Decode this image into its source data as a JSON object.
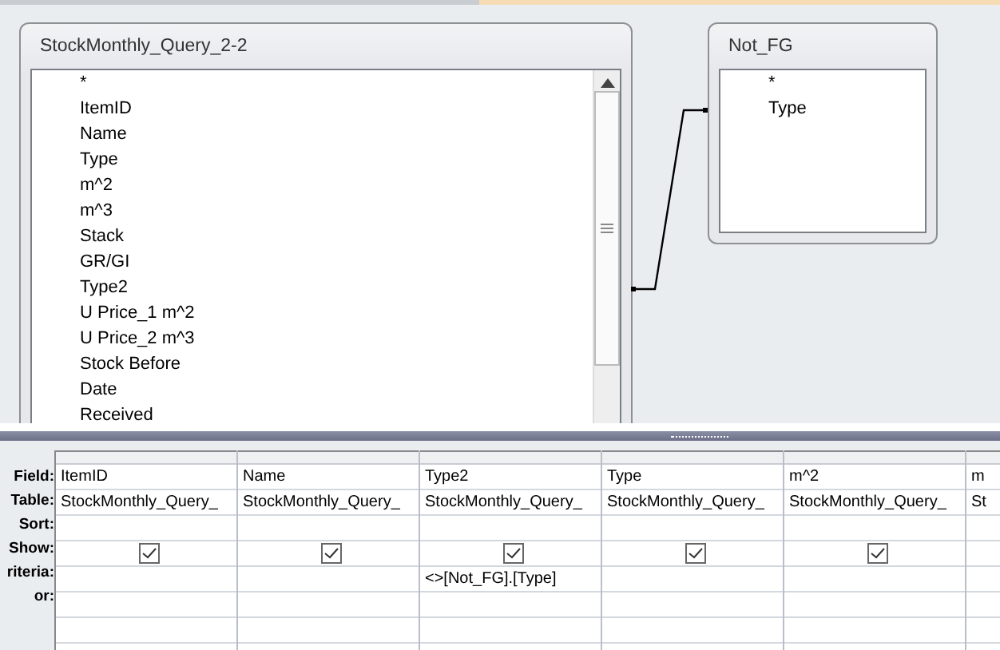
{
  "design": {
    "tables": [
      {
        "title": "StockMonthly_Query_2-2",
        "fields": [
          "*",
          "ItemID",
          "Name",
          "Type",
          "m^2",
          "m^3",
          "Stack",
          "GR/GI",
          "Type2",
          "U Price_1 m^2",
          "U Price_2 m^3",
          "Stock Before",
          "Date",
          "Received"
        ],
        "scrollbar": true
      },
      {
        "title": "Not_FG",
        "fields": [
          "*",
          "Type"
        ],
        "scrollbar": false
      }
    ]
  },
  "grid": {
    "row_labels": [
      "Field:",
      "Table:",
      "Sort:",
      "Show:",
      "riteria:",
      "or:"
    ],
    "columns": [
      {
        "field": "ItemID",
        "table": "StockMonthly_Query_",
        "show": true
      },
      {
        "field": "Name",
        "table": "StockMonthly_Query_",
        "show": true
      },
      {
        "field": "Type2",
        "table": "StockMonthly_Query_",
        "show": true,
        "criteria": "<>[Not_FG].[Type]"
      },
      {
        "field": "Type",
        "table": "StockMonthly_Query_",
        "show": true
      },
      {
        "field": "m^2",
        "table": "StockMonthly_Query_",
        "show": true
      },
      {
        "field": "m",
        "table": "St"
      }
    ]
  }
}
